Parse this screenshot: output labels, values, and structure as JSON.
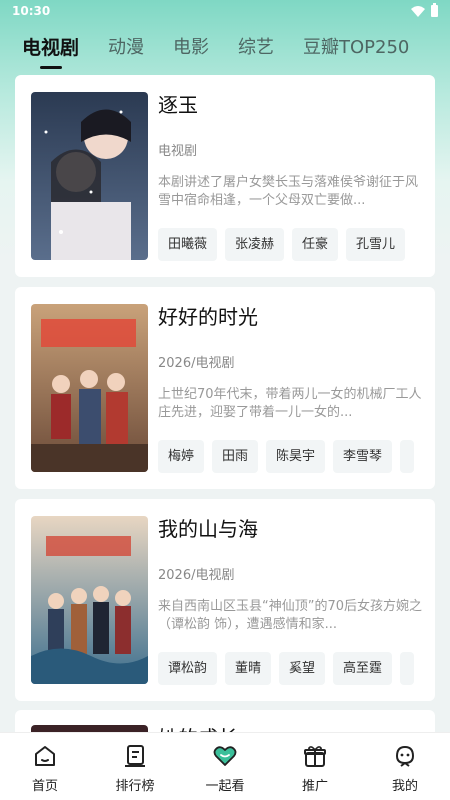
{
  "status_bar": {
    "time": "10:30"
  },
  "tabs": [
    {
      "label": "电视剧",
      "active": true
    },
    {
      "label": "动漫"
    },
    {
      "label": "电影"
    },
    {
      "label": "综艺"
    },
    {
      "label": "豆瓣TOP250"
    }
  ],
  "cards": [
    {
      "title": "逐玉",
      "meta": "电视剧",
      "desc": "本剧讲述了屠户女樊长玉与落难侯爷谢征于风雪中宿命相逢，一个父母双亡要做...",
      "cast": [
        "田曦薇",
        "张凌赫",
        "任豪",
        "孔雪儿"
      ]
    },
    {
      "title": "好好的时光",
      "meta": "2026/电视剧",
      "desc": "上世纪70年代末，带着两儿一女的机械厂工人庄先进，迎娶了带着一儿一女的...",
      "cast": [
        "梅婷",
        "田雨",
        "陈昊宇",
        "李雪琴"
      ]
    },
    {
      "title": "我的山与海",
      "meta": "2026/电视剧",
      "desc": "来自西南山区玉县“神仙顶”的70后女孩方婉之（谭松韵 饰），遭遇感情和家...",
      "cast": [
        "谭松韵",
        "董晴",
        "奚望",
        "高至霆"
      ]
    }
  ],
  "partial_card": {
    "title": "她的成长"
  },
  "bottom_nav": [
    {
      "label": "首页",
      "icon": "home-icon"
    },
    {
      "label": "排行榜",
      "icon": "ranking-icon"
    },
    {
      "label": "一起看",
      "icon": "heart-icon",
      "accent": "#3bbf9a"
    },
    {
      "label": "推广",
      "icon": "gift-icon"
    },
    {
      "label": "我的",
      "icon": "profile-icon"
    }
  ],
  "colors": {
    "accent": "#3bbf9a",
    "header_gradient_top": "#7fd8c4"
  }
}
